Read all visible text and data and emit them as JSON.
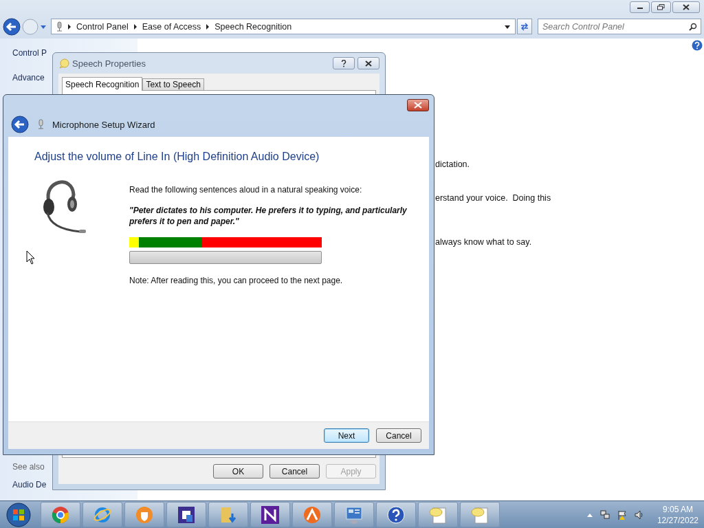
{
  "explorer": {
    "breadcrumbs": [
      "Control Panel",
      "Ease of Access",
      "Speech Recognition"
    ],
    "search": {
      "placeholder": "Search Control Panel"
    },
    "sidebar": {
      "items": [
        "Control P",
        "Advance"
      ],
      "see_also": {
        "heading": "See also",
        "items": [
          "Audio De"
        ]
      }
    },
    "content_lines": [
      "dictation.",
      "erstand your voice.  Doing this",
      "always know what to say."
    ]
  },
  "speech_properties": {
    "title": "Speech Properties",
    "tabs": [
      {
        "label": "Speech Recognition",
        "selected": true
      },
      {
        "label": "Text to Speech",
        "selected": false
      }
    ],
    "buttons": [
      {
        "label": "OK",
        "disabled": false
      },
      {
        "label": "Cancel",
        "disabled": false
      },
      {
        "label": "Apply",
        "disabled": true
      }
    ]
  },
  "wizard": {
    "title": "Microphone Setup Wizard",
    "heading": "Adjust the volume of Line In (High Definition Audio Device)",
    "instruction": "Read the following sentences aloud in a natural speaking voice:",
    "quote": "\"Peter dictates to his computer. He prefers it to typing, and particularly prefers it to pen and paper.\"",
    "note": "Note: After reading this, you can proceed to the next page.",
    "buttons": [
      {
        "label": "Next",
        "default": true
      },
      {
        "label": "Cancel",
        "default": false
      }
    ]
  },
  "taskbar": {
    "clock": {
      "time": "9:05 AM",
      "date": "12/27/2022"
    }
  }
}
